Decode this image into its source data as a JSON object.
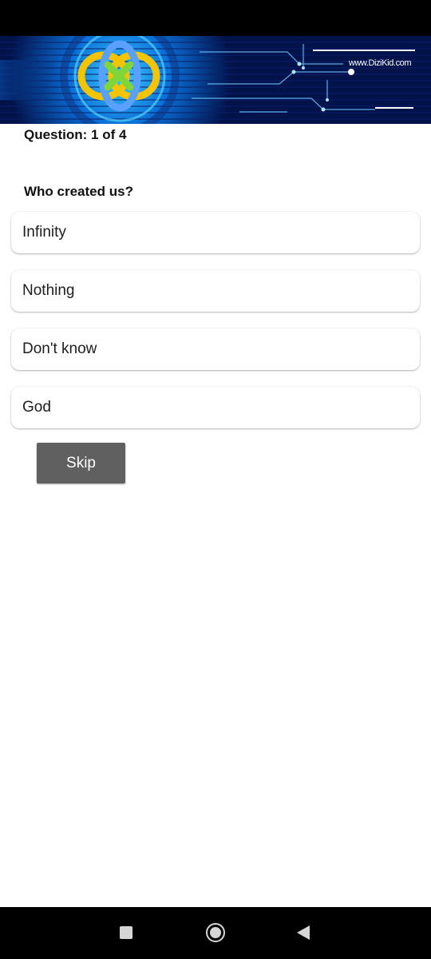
{
  "banner": {
    "url_text": "www.DiziKid.com"
  },
  "quiz": {
    "counter": "Question: 1 of 4",
    "question": "Who created us?",
    "answers": [
      {
        "label": "Infinity"
      },
      {
        "label": "Nothing"
      },
      {
        "label": "Don't know"
      },
      {
        "label": "God"
      }
    ],
    "skip_label": "Skip"
  },
  "navigation": {
    "buttons": [
      "recents",
      "home",
      "back"
    ]
  },
  "colors": {
    "banner_background": "#02124a",
    "skip_button": "#606060",
    "system_bars": "#000000"
  }
}
